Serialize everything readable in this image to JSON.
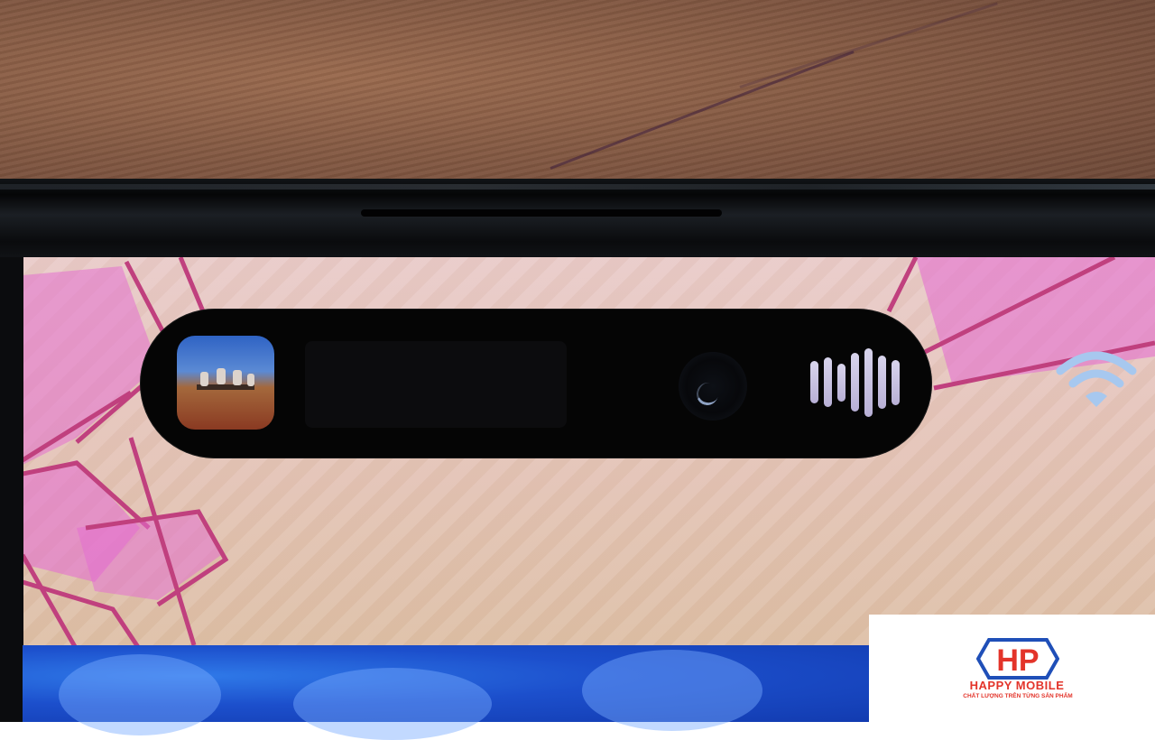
{
  "scene": {
    "description_free": true,
    "colors": {
      "wood": "#7e5540",
      "frame": "#0a0b0d",
      "screen": "#e4c2b8",
      "ribbon": "#e46fd0",
      "island": "#050505",
      "waveform": "#c8c2e2",
      "wifi": "#a7c8ef",
      "blue_wallpaper": "#1c4fcc"
    }
  },
  "dynamic_island": {
    "album_art_icon": "album-art-thumbnail",
    "camera_icon": "front-camera-lens",
    "waveform_icon": "audio-waveform-icon",
    "waveform_levels": [
      0.62,
      0.72,
      0.55,
      0.85,
      1.0,
      0.78,
      0.66
    ]
  },
  "status_bar": {
    "wifi_icon": "wifi-icon"
  },
  "watermark": {
    "mark": "HP",
    "name": "HAPPY MOBILE",
    "tagline": "CHẤT LƯỢNG TRÊN TỪNG SẢN PHẨM",
    "color": "#e3342a",
    "mark_outline_color": "#1f4fb8"
  }
}
